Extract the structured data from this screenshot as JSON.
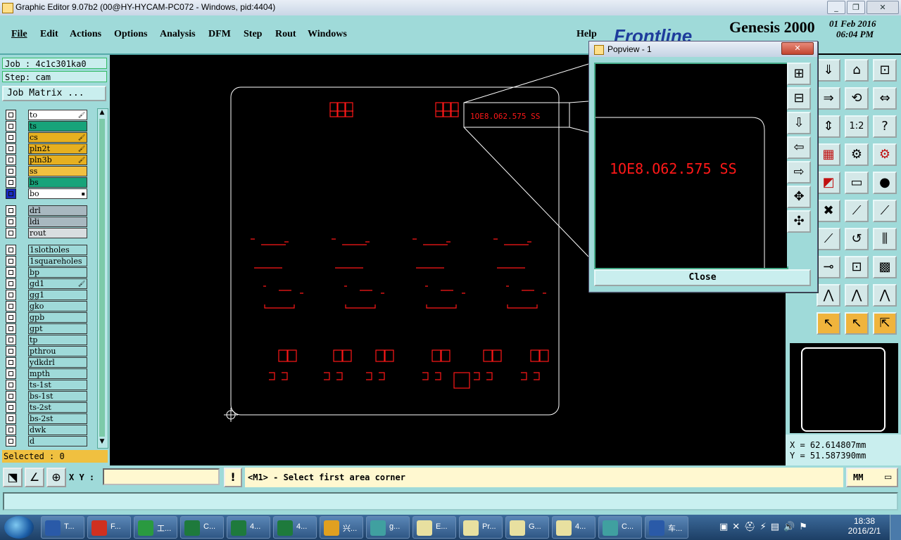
{
  "window": {
    "title": "Graphic Editor 9.07b2 (00@HY-HYCAM-PC072 - Windows, pid:4404)"
  },
  "menu": [
    "File",
    "Edit",
    "Actions",
    "Options",
    "Analysis",
    "DFM",
    "Step",
    "Rout",
    "Windows"
  ],
  "help_label": "Help",
  "brand": {
    "logo": "Frontline",
    "product": "Genesis 2000",
    "date": "01 Feb 2016",
    "time": "06:04 PM"
  },
  "job": {
    "job_label": "Job : 4c1c301ka0",
    "step_label": "Step: cam",
    "matrix_button": "Job Matrix ..."
  },
  "layers": [
    {
      "name": "to",
      "color": "#ffffff",
      "mark": "🖌"
    },
    {
      "name": "ts",
      "color": "#17a37a",
      "mark": ""
    },
    {
      "name": "cs",
      "color": "#e6b020",
      "mark": "🖌"
    },
    {
      "name": "pln2t",
      "color": "#e6b020",
      "mark": "🖌"
    },
    {
      "name": "pln3b",
      "color": "#e6b020",
      "mark": "🖌"
    },
    {
      "name": "ss",
      "color": "#f0c040",
      "mark": ""
    },
    {
      "name": "bs",
      "color": "#17a37a",
      "mark": ""
    },
    {
      "name": "bo",
      "color": "#ffffff",
      "mark": "▪"
    },
    {
      "name": "drl",
      "color": "#a8b8c0",
      "mark": ""
    },
    {
      "name": "ldi",
      "color": "#a8b8c0",
      "mark": ""
    },
    {
      "name": "rout",
      "color": "#d8dde0",
      "mark": ""
    },
    {
      "name": "1slotholes",
      "color": "#9fdad9",
      "mark": ""
    },
    {
      "name": "1squareholes",
      "color": "#9fdad9",
      "mark": ""
    },
    {
      "name": "bp",
      "color": "#9fdad9",
      "mark": ""
    },
    {
      "name": "gd1",
      "color": "#9fdad9",
      "mark": "🖌"
    },
    {
      "name": "gg1",
      "color": "#9fdad9",
      "mark": ""
    },
    {
      "name": "gko",
      "color": "#9fdad9",
      "mark": ""
    },
    {
      "name": "gpb",
      "color": "#9fdad9",
      "mark": ""
    },
    {
      "name": "gpt",
      "color": "#9fdad9",
      "mark": ""
    },
    {
      "name": "tp",
      "color": "#9fdad9",
      "mark": ""
    },
    {
      "name": "pthrou",
      "color": "#9fdad9",
      "mark": ""
    },
    {
      "name": "ydkdrl",
      "color": "#9fdad9",
      "mark": ""
    },
    {
      "name": "mpth",
      "color": "#9fdad9",
      "mark": ""
    },
    {
      "name": "ts-1st",
      "color": "#9fdad9",
      "mark": ""
    },
    {
      "name": "bs-1st",
      "color": "#9fdad9",
      "mark": ""
    },
    {
      "name": "ts-2st",
      "color": "#9fdad9",
      "mark": ""
    },
    {
      "name": "bs-2st",
      "color": "#9fdad9",
      "mark": ""
    },
    {
      "name": "dwk",
      "color": "#9fdad9",
      "mark": ""
    },
    {
      "name": "d",
      "color": "#9fdad9",
      "mark": ""
    }
  ],
  "selected_label": "Selected : 0",
  "board_text": "1OE8.O62.575 SS",
  "popview": {
    "title": "Popview - 1",
    "zoom_text": "1OE8.O62.575 SS",
    "close_label": "Close"
  },
  "coords": {
    "x": "X = 62.614807mm",
    "y": "Y = 51.587390mm"
  },
  "status": {
    "xy_label": "X Y :",
    "xy_value": "",
    "message": "<M1> - Select first area corner",
    "units": "MM"
  },
  "toolbar_icons": [
    "zoom-home",
    "zoom-window",
    "layer-view",
    "redraw",
    "measure",
    "ratio",
    "help",
    "copy",
    "snap",
    "drill-view",
    "grid",
    "net-view",
    "drill-view-2",
    "line-tool",
    "ruler",
    "pad-tool",
    "delete",
    "move",
    "connect",
    "arc",
    "edge",
    "pad",
    "nets",
    "cross",
    "trace",
    "arc-feature",
    "select",
    "select-2",
    "select-3",
    "route"
  ],
  "taskbar": [
    {
      "label": "T...",
      "color": "#2a5aa8"
    },
    {
      "label": "F...",
      "color": "#d03020"
    },
    {
      "label": "工...",
      "color": "#2a9a40"
    },
    {
      "label": "C...",
      "color": "#1e7a3c"
    },
    {
      "label": "4...",
      "color": "#1e7a3c"
    },
    {
      "label": "4...",
      "color": "#1e7a3c"
    },
    {
      "label": "兴...",
      "color": "#e0a020"
    },
    {
      "label": "g...",
      "color": "#40a0a0"
    },
    {
      "label": "E...",
      "color": "#e8e0a0"
    },
    {
      "label": "Pr...",
      "color": "#e8e0a0"
    },
    {
      "label": "G...",
      "color": "#e8e0a0"
    },
    {
      "label": "4...",
      "color": "#e8e0a0"
    },
    {
      "label": "C...",
      "color": "#40a0a0"
    },
    {
      "label": "车...",
      "color": "#2a5aa8"
    }
  ],
  "clock": {
    "time": "18:38",
    "date": "2016/2/1"
  }
}
